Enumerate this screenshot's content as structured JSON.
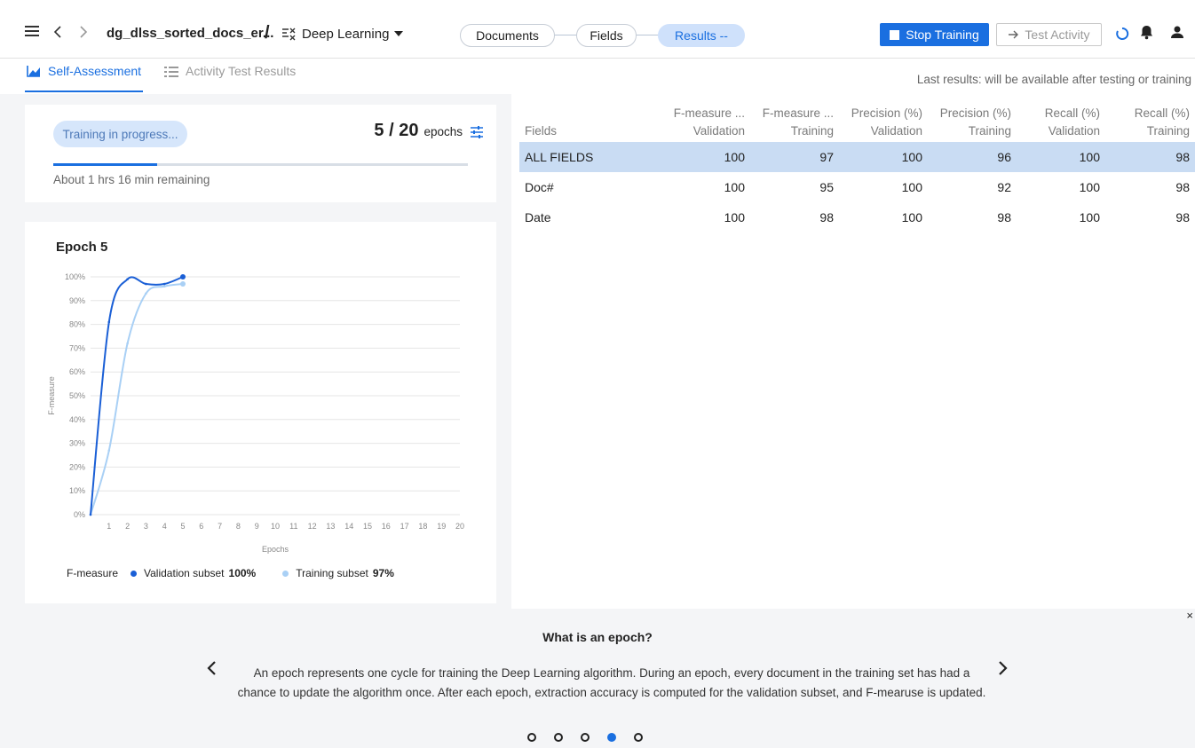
{
  "topbar": {
    "project_name": "dg_dlss_sorted_docs_er...",
    "separator": "/",
    "skill": "Deep Learning",
    "steps": [
      {
        "label": "Documents",
        "active": false
      },
      {
        "label": "Fields",
        "active": false
      },
      {
        "label": "Results --",
        "active": true
      }
    ],
    "stop_training_label": "Stop Training",
    "test_activity_label": "Test Activity",
    "icons": [
      "hamburger-icon",
      "back-icon",
      "forward-icon",
      "skill-icon",
      "dropdown-caret-icon",
      "stop-icon",
      "arrow-right-icon",
      "loading-spinner-icon",
      "bell-icon",
      "user-icon"
    ]
  },
  "subtabs": {
    "self_assessment": "Self-Assessment",
    "activity_test_results": "Activity Test Results",
    "last_results": "Last results: will be available after testing or training"
  },
  "progress": {
    "status": "Training in progress...",
    "epochs_current": 5,
    "epochs_total": 20,
    "epochs_text": "5 / 20",
    "epochs_word": "epochs",
    "fraction": 0.25,
    "remaining": "About 1 hrs 16 min remaining"
  },
  "chart": {
    "title": "Epoch 5",
    "ylabel": "F-measure",
    "xlabel": "Epochs",
    "legend_label": "F-measure",
    "legend_validation": "Validation subset",
    "legend_validation_value": "100%",
    "legend_training": "Training subset",
    "legend_training_value": "97%",
    "y_ticks": [
      "0%",
      "10%",
      "20%",
      "30%",
      "40%",
      "50%",
      "60%",
      "70%",
      "80%",
      "90%",
      "100%"
    ],
    "x_ticks": [
      "1",
      "2",
      "3",
      "4",
      "5",
      "6",
      "7",
      "8",
      "9",
      "10",
      "11",
      "12",
      "13",
      "14",
      "15",
      "16",
      "17",
      "18",
      "19",
      "20"
    ]
  },
  "chart_data": {
    "type": "line",
    "title": "Epoch 5",
    "xlabel": "Epochs",
    "ylabel": "F-measure",
    "xlim": [
      0,
      20
    ],
    "ylim": [
      0,
      100
    ],
    "grid": true,
    "legend_position": "bottom",
    "series": [
      {
        "name": "Validation subset",
        "color": "#1a5fd6",
        "x": [
          0,
          1,
          2,
          3,
          4,
          5
        ],
        "y": [
          0,
          81,
          99,
          97,
          97,
          100
        ]
      },
      {
        "name": "Training subset",
        "color": "#a9d0f5",
        "x": [
          0,
          1,
          2,
          3,
          4,
          5
        ],
        "y": [
          0,
          27,
          72,
          93,
          96,
          97
        ]
      }
    ]
  },
  "table": {
    "headers": [
      {
        "line1": "",
        "line2": "Fields"
      },
      {
        "line1": "F-measure ...",
        "line2": "Validation"
      },
      {
        "line1": "F-measure ...",
        "line2": "Training"
      },
      {
        "line1": "Precision (%)",
        "line2": "Validation"
      },
      {
        "line1": "Precision (%)",
        "line2": "Training"
      },
      {
        "line1": "Recall (%)",
        "line2": "Validation"
      },
      {
        "line1": "Recall (%)",
        "line2": "Training"
      }
    ],
    "rows": [
      {
        "cells": [
          "ALL FIELDS",
          "100",
          "97",
          "100",
          "96",
          "100",
          "98"
        ],
        "selected": true
      },
      {
        "cells": [
          "Doc#",
          "100",
          "95",
          "100",
          "92",
          "100",
          "98"
        ],
        "selected": false
      },
      {
        "cells": [
          "Date",
          "100",
          "98",
          "100",
          "98",
          "100",
          "98"
        ],
        "selected": false
      }
    ]
  },
  "help": {
    "title": "What is an epoch?",
    "text": "An epoch represents one cycle for training the Deep Learning algorithm. During an epoch, every document in the training set has had a chance to update the algorithm once. After each epoch, extraction accuracy is computed for the validation subset, and F-mearuse is updated.",
    "close": "×",
    "dots_total": 5,
    "dots_active": 3
  },
  "colors": {
    "accent": "#1a6fe0",
    "validation": "#1a5fd6",
    "training": "#a9d0f5",
    "selected_row": "#c9dcf3"
  }
}
